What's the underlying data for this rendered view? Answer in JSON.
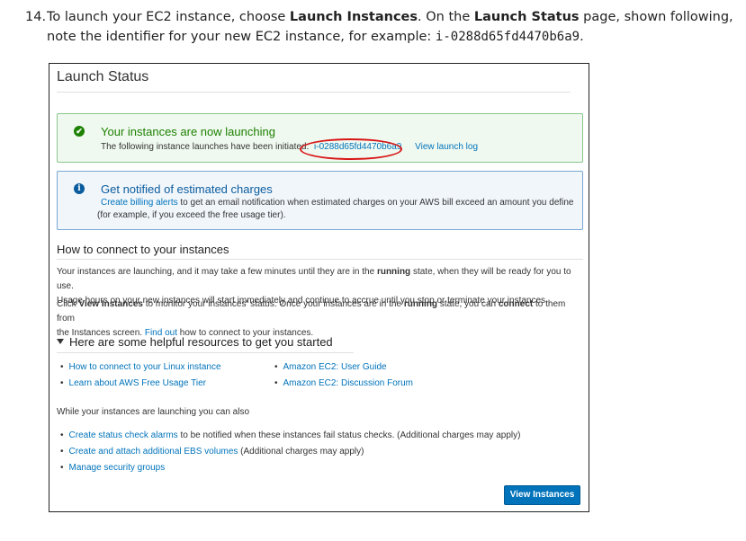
{
  "doc": {
    "step_number": "14.",
    "line1_pre": "To launch your EC2 instance, choose ",
    "line1_b1": "Launch Instances",
    "line1_mid": ". On the ",
    "line1_b2": "Launch Status",
    "line1_post": " page, shown following,",
    "line2_pre": "note the identifier for your new EC2 instance, for example: ",
    "line2_code": "i-0288d65fd4470b6a9",
    "line2_post": "."
  },
  "page_title": "Launch Status",
  "success_alert": {
    "title": "Your instances are now launching",
    "body": "The following instance launches have been initiated:",
    "instance_id": "i-0288d65fd4470b6a9",
    "log_link": "View launch log"
  },
  "info_alert": {
    "title": "Get notified of estimated charges",
    "link": "Create billing alerts",
    "body_rest": " to get an email notification when estimated charges on your AWS bill exceed an amount you define",
    "body_line2": "(for example, if you exceed the free usage tier)."
  },
  "connect": {
    "title": "How to connect to your instances",
    "p1_a": "Your instances are launching, and it may take a few minutes until they are in the ",
    "p1_b": "running",
    "p1_c": " state, when they will be ready for you to use.",
    "p1_line2": "Usage hours on your new instances will start immediately and continue to accrue until you stop or terminate your instances.",
    "p2_a": "Click ",
    "p2_b": "View Instances",
    "p2_c": " to monitor your instances' status. Once your instances are in the ",
    "p2_d": "running",
    "p2_e": " state, you can ",
    "p2_f": "connect",
    "p2_g": " to them from",
    "p2_line2_a": "the Instances screen. ",
    "p2_line2_link": "Find out",
    "p2_line2_b": " how to connect to your instances."
  },
  "resources": {
    "title": "Here are some helpful resources to get you started",
    "left": [
      "How to connect to your Linux instance",
      "Learn about AWS Free Usage Tier"
    ],
    "right": [
      "Amazon EC2: User Guide",
      "Amazon EC2: Discussion Forum"
    ]
  },
  "also": {
    "title": "While your instances are launching you can also",
    "items": [
      {
        "link": "Create status check alarms",
        "rest": " to be notified when these instances fail status checks. (Additional charges may apply)"
      },
      {
        "link": "Create and attach additional EBS volumes",
        "rest": " (Additional charges may apply)"
      },
      {
        "link": "Manage security groups",
        "rest": ""
      }
    ]
  },
  "view_instances_button": "View Instances",
  "colors": {
    "success": "#1d8102",
    "info": "#0a5c9e",
    "link": "#0073bb",
    "button": "#0073bb",
    "highlight": "#d81616"
  }
}
